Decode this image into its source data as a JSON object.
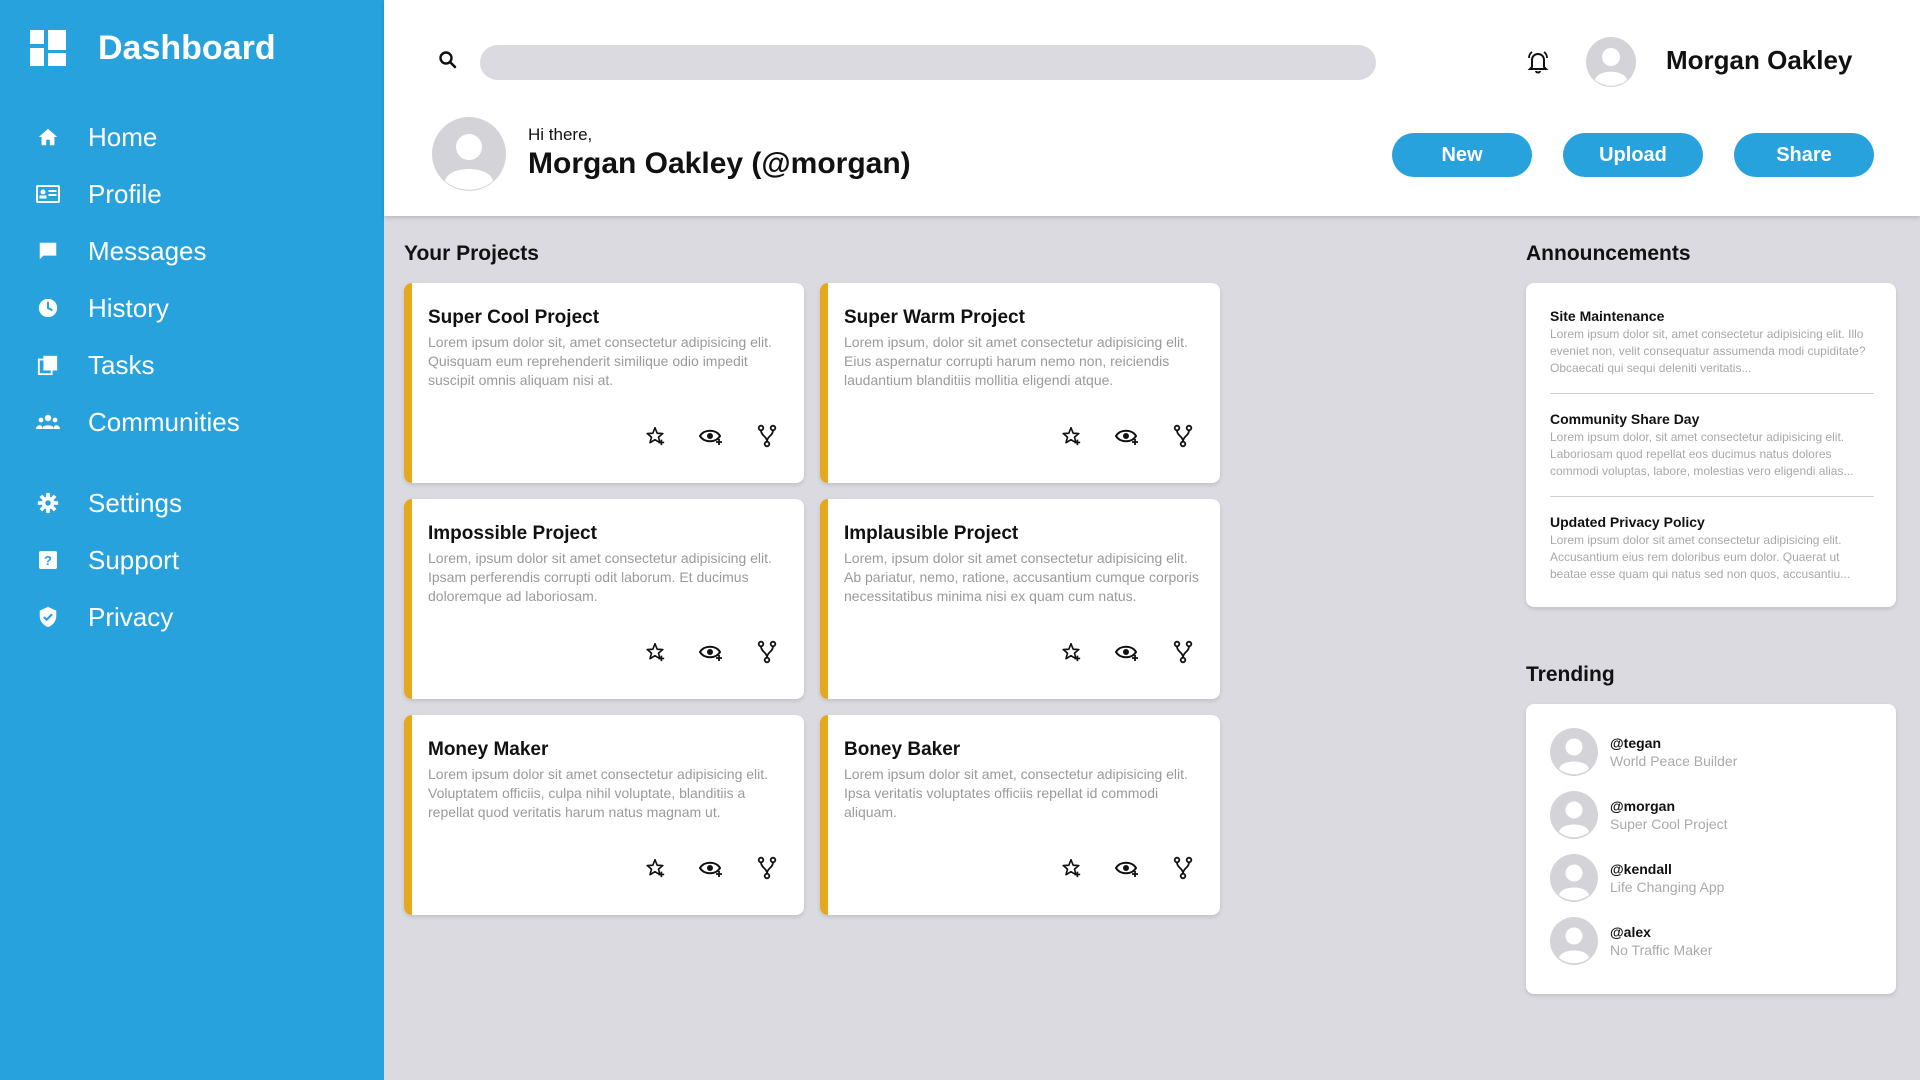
{
  "sidebar": {
    "title": "Dashboard",
    "items": [
      {
        "label": "Home",
        "icon": "home-icon"
      },
      {
        "label": "Profile",
        "icon": "id-card-icon"
      },
      {
        "label": "Messages",
        "icon": "message-icon"
      },
      {
        "label": "History",
        "icon": "clock-icon"
      },
      {
        "label": "Tasks",
        "icon": "tasks-icon"
      },
      {
        "label": "Communities",
        "icon": "people-icon"
      },
      {
        "label": "Settings",
        "icon": "gear-icon"
      },
      {
        "label": "Support",
        "icon": "help-icon"
      },
      {
        "label": "Privacy",
        "icon": "shield-icon"
      }
    ]
  },
  "header": {
    "search_placeholder": "",
    "user_name": "Morgan Oakley",
    "greeting": "Hi there,",
    "greeting_name": "Morgan Oakley (@morgan)",
    "buttons": {
      "new": "New",
      "upload": "Upload",
      "share": "Share"
    }
  },
  "projects": {
    "title": "Your Projects",
    "items": [
      {
        "title": "Super Cool Project",
        "desc": "Lorem ipsum dolor sit, amet consectetur adipisicing elit. Quisquam eum reprehenderit similique odio impedit suscipit omnis aliquam nisi at."
      },
      {
        "title": "Super Warm Project",
        "desc": "Lorem ipsum, dolor sit amet consectetur adipisicing elit. Eius aspernatur corrupti harum nemo non, reiciendis laudantium blanditiis mollitia eligendi atque."
      },
      {
        "title": "Impossible Project",
        "desc": "Lorem, ipsum dolor sit amet consectetur adipisicing elit. Ipsam perferendis corrupti odit laborum. Et ducimus doloremque ad laboriosam."
      },
      {
        "title": "Implausible Project",
        "desc": "Lorem, ipsum dolor sit amet consectetur adipisicing elit. Ab pariatur, nemo, ratione, accusantium cumque corporis necessitatibus minima nisi ex quam cum natus."
      },
      {
        "title": "Money Maker",
        "desc": "Lorem ipsum dolor sit amet consectetur adipisicing elit. Voluptatem officiis, culpa nihil voluptate, blanditiis a repellat quod veritatis harum natus magnam ut."
      },
      {
        "title": "Boney Baker",
        "desc": "Lorem ipsum dolor sit amet, consectetur adipisicing elit. Ipsa veritatis voluptates officiis repellat id commodi aliquam."
      }
    ]
  },
  "announcements": {
    "title": "Announcements",
    "items": [
      {
        "title": "Site Maintenance",
        "body": "Lorem ipsum dolor sit, amet consectetur adipisicing elit. Illo eveniet non, velit consequatur assumenda modi cupiditate? Obcaecati qui sequi deleniti veritatis..."
      },
      {
        "title": "Community Share Day",
        "body": "Lorem ipsum dolor, sit amet consectetur adipisicing elit. Laboriosam quod repellat eos ducimus natus dolores commodi voluptas, labore, molestias vero eligendi alias..."
      },
      {
        "title": "Updated Privacy Policy",
        "body": "Lorem ipsum dolor sit amet consectetur adipisicing elit. Accusantium eius rem doloribus eum dolor. Quaerat ut beatae esse quam qui natus sed non quos, accusantiu..."
      }
    ]
  },
  "trending": {
    "title": "Trending",
    "items": [
      {
        "handle": "@tegan",
        "sub": "World Peace Builder"
      },
      {
        "handle": "@morgan",
        "sub": "Super Cool Project"
      },
      {
        "handle": "@kendall",
        "sub": "Life Changing App"
      },
      {
        "handle": "@alex",
        "sub": "No Traffic Maker"
      }
    ]
  },
  "colors": {
    "primary": "#27a2dc",
    "accent": "#e6a81e",
    "background": "#dadae0"
  }
}
